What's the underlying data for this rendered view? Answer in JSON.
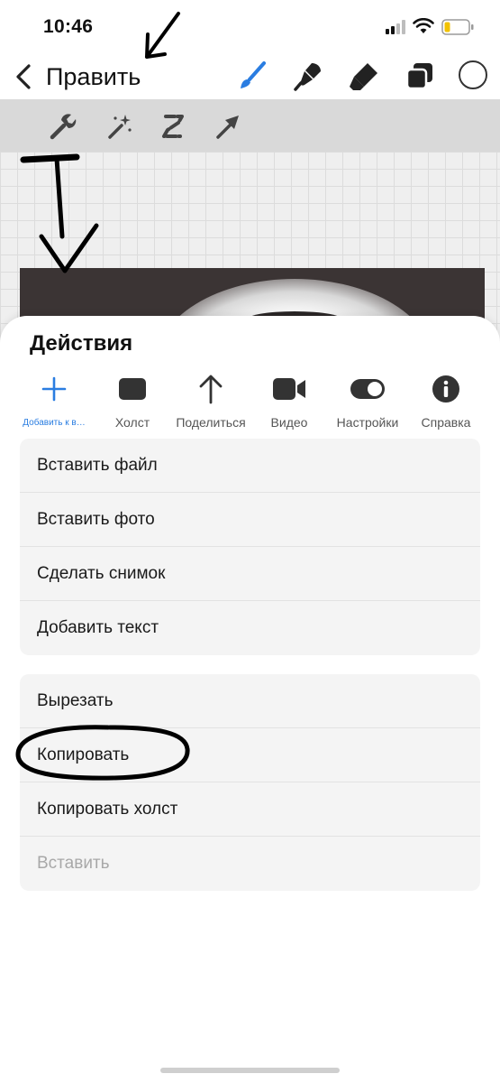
{
  "status_bar": {
    "time": "10:46"
  },
  "app_bar": {
    "title": "Править",
    "tools": [
      "brush-icon",
      "smudge-icon",
      "eraser-icon",
      "layers-icon"
    ],
    "accent_color": "#2a7de1"
  },
  "sub_toolbar": {
    "tools": [
      "wrench-icon",
      "magic-wand-icon",
      "selection-icon",
      "transform-arrow-icon"
    ]
  },
  "sheet": {
    "title": "Действия",
    "tabs": [
      {
        "label": "Добавить к в…",
        "icon": "plus-icon",
        "active": true
      },
      {
        "label": "Холст",
        "icon": "canvas-icon"
      },
      {
        "label": "Поделиться",
        "icon": "share-arrow-icon"
      },
      {
        "label": "Видео",
        "icon": "video-camera-icon"
      },
      {
        "label": "Настройки",
        "icon": "toggle-icon"
      },
      {
        "label": "Справка",
        "icon": "info-icon"
      }
    ],
    "group1": [
      "Вставить файл",
      "Вставить фото",
      "Сделать снимок",
      "Добавить текст"
    ],
    "group2": [
      "Вырезать",
      "Копировать",
      "Копировать холст",
      "Вставить"
    ]
  }
}
